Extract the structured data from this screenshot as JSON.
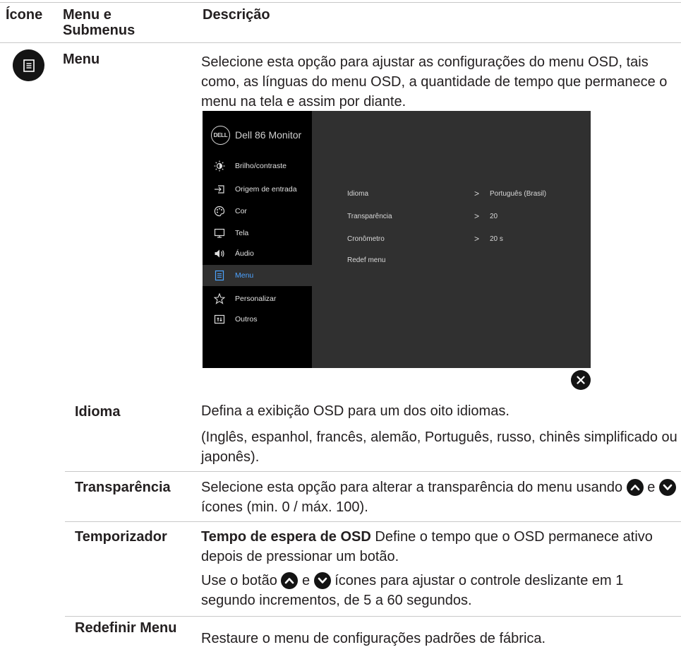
{
  "header": {
    "icon_col": "Ícone",
    "menu_col": "Menu e Submenus",
    "desc_col": "Descrição"
  },
  "menu_row": {
    "icon": "menu-list-icon",
    "name": "Menu",
    "description": "Selecione esta opção para ajustar as configurações do menu OSD, tais como, as línguas do menu OSD, a quantidade de tempo que permanece o menu na tela e assim por diante."
  },
  "osd": {
    "logo": "DELL",
    "title": "Dell 86 Monitor",
    "nav": [
      {
        "label": "Brilho/contraste",
        "icon": "brightness-icon"
      },
      {
        "label": "Origem de entrada",
        "icon": "input-source-icon"
      },
      {
        "label": "Cor",
        "icon": "palette-icon"
      },
      {
        "label": "Tela",
        "icon": "display-icon"
      },
      {
        "label": "Áudio",
        "icon": "speaker-icon"
      },
      {
        "label": "Menu",
        "icon": "menu-list-icon",
        "active": true
      },
      {
        "label": "Personalizar",
        "icon": "star-icon"
      },
      {
        "label": "Outros",
        "icon": "others-icon"
      }
    ],
    "settings": [
      {
        "label": "Idioma",
        "value": "Português (Brasil)"
      },
      {
        "label": "Transparência",
        "value": "20"
      },
      {
        "label": "Cronômetro",
        "value": "20 s"
      },
      {
        "label": "Redef menu",
        "value": ""
      }
    ],
    "active_color": "#4da3ff"
  },
  "submenus": {
    "idioma": {
      "name": "Idioma",
      "desc1": "Defina a exibição OSD para um dos oito idiomas.",
      "desc2": "(Inglês, espanhol, francês, alemão, Português, russo, chinês simplificado ou japonês)."
    },
    "transparencia": {
      "name": "Transparência",
      "desc_a": "Selecione esta opção para alterar a transparência do menu usando",
      "desc_and": "e",
      "desc_b": "ícones (min. 0 / máx. 100)."
    },
    "temporizador": {
      "name": "Temporizador",
      "desc_bold": "Tempo de espera de OSD",
      "desc1": "Define o tempo que o OSD permanece ativo depois de pressionar um botão.",
      "desc2_a": "Use o botão",
      "desc2_and": "e",
      "desc2_b": "ícones para ajustar o controle deslizante em 1 segundo incrementos, de 5 a 60 segundos."
    },
    "redefinir": {
      "name": "Redefinir Menu",
      "desc": "Restaure o menu de configurações padrões de fábrica."
    }
  }
}
